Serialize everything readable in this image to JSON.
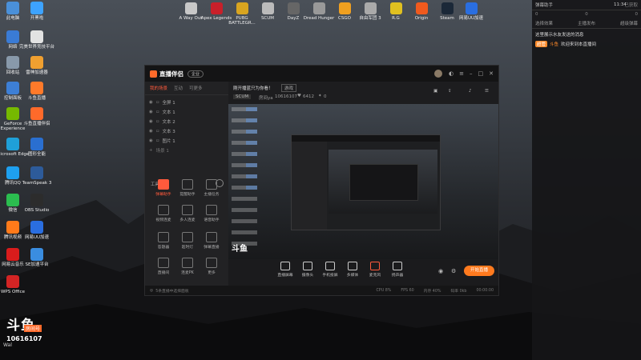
{
  "desktop_left": [
    {
      "label": "此电脑",
      "color": "#4a90d9"
    },
    {
      "label": "开黑啦",
      "color": "#3da3ff"
    },
    {
      "label": "网络",
      "color": "#3a7bd5"
    },
    {
      "label": "完美世界竞技平台",
      "color": "#e2e2e2"
    },
    {
      "label": "回收站",
      "color": "#8899aa"
    },
    {
      "label": "雷神加速器",
      "color": "#f0a030"
    },
    {
      "label": "控制面板",
      "color": "#3d7fd6"
    },
    {
      "label": "斗鱼直播",
      "color": "#ff7a2a"
    },
    {
      "label": "GeForce Experience",
      "color": "#76b900"
    },
    {
      "label": "斗鱼直播伴侣",
      "color": "#ff6a2a"
    },
    {
      "label": "Microsoft Edge",
      "color": "#1fa0d8"
    },
    {
      "label": "图形全能",
      "color": "#2a6fd0"
    },
    {
      "label": "腾讯QQ",
      "color": "#1ea0f0"
    },
    {
      "label": "TeamSpeak 3",
      "color": "#2d5b9a"
    },
    {
      "label": "微信",
      "color": "#2bbd4f"
    },
    {
      "label": "OBS Studio",
      "color": "#2c2c2c"
    },
    {
      "label": "腾讯视频",
      "color": "#ff7a1a"
    },
    {
      "label": "网易UU加速",
      "color": "#2a6ee0"
    },
    {
      "label": "网易云音乐",
      "color": "#d91c1c"
    },
    {
      "label": "SE加速平台",
      "color": "#3a8de0"
    },
    {
      "label": "WPS Office",
      "color": "#d32424"
    }
  ],
  "desktop_top": [
    {
      "label": "A Way Out",
      "color": "#c8c8c8"
    },
    {
      "label": "Apex Legends",
      "color": "#c8202a"
    },
    {
      "label": "PUBG BATTLEGR...",
      "color": "#d9a520"
    },
    {
      "label": "SCUM",
      "color": "#bbbbbb"
    },
    {
      "label": "DayZ",
      "color": "#666"
    },
    {
      "label": "Dread Hunger",
      "color": "#999"
    },
    {
      "label": "CSGO",
      "color": "#f0a020"
    },
    {
      "label": "自由军团 3",
      "color": "#aaa"
    },
    {
      "label": "R.G",
      "color": "#e0c020"
    },
    {
      "label": "Origin",
      "color": "#f05a1e"
    },
    {
      "label": "Steam",
      "color": "#1b2838"
    },
    {
      "label": "网易UU加速",
      "color": "#2a6ee0"
    }
  ],
  "douyu_logo": {
    "text": "斗鱼",
    "sub": "房间号",
    "room": "10616107"
  },
  "watermark": "Wal",
  "right_panel": {
    "title": "弹幕助手",
    "status": "已获取",
    "counts": [
      "0",
      "0",
      "0"
    ],
    "tabs": [
      "选择效果",
      "主播发布",
      "超级弹幕"
    ],
    "msg1": "这里展示水友发送的消息",
    "msg2_tag": "超管",
    "msg2_user": "斗鱼",
    "msg2_text": "欢迎来到本直播间"
  },
  "app": {
    "name": "直播伴侣",
    "badge": "企业",
    "left_tabs": [
      "我的场景",
      "互动",
      "可更多"
    ],
    "scenes": [
      "全屏 1",
      "文本 1",
      "文本 2",
      "文本 3",
      "图片 1"
    ],
    "add_scene": "场景 1",
    "tools_title": "工具箱",
    "tools": [
      "弹幕助手",
      "提醒助手",
      "主播任务",
      "视频连麦",
      "多人连麦",
      "语音助手",
      "答题器",
      "超时灯",
      "弹幕直播",
      "直播间",
      "连麦PK",
      "更多"
    ],
    "stream_title": "刚开播蓝只为你看！",
    "stream_tag": "游戏",
    "game": "SCUM",
    "room_label": "房间ya",
    "room_id": "10616107",
    "fans": "6412",
    "gifts": "0",
    "bottom_tools": [
      "直播屏幕",
      "摄像头",
      "手机投屏",
      "多媒体",
      "麦克风",
      "扬声器"
    ],
    "start_button": "开始直播",
    "notice": "5条直播中选择面板",
    "status_items": [
      "CPU 8%",
      "FPS 60",
      "内存 40%",
      "码率 0kb",
      "00:00:00"
    ]
  },
  "taskbar_clock": "11:34"
}
